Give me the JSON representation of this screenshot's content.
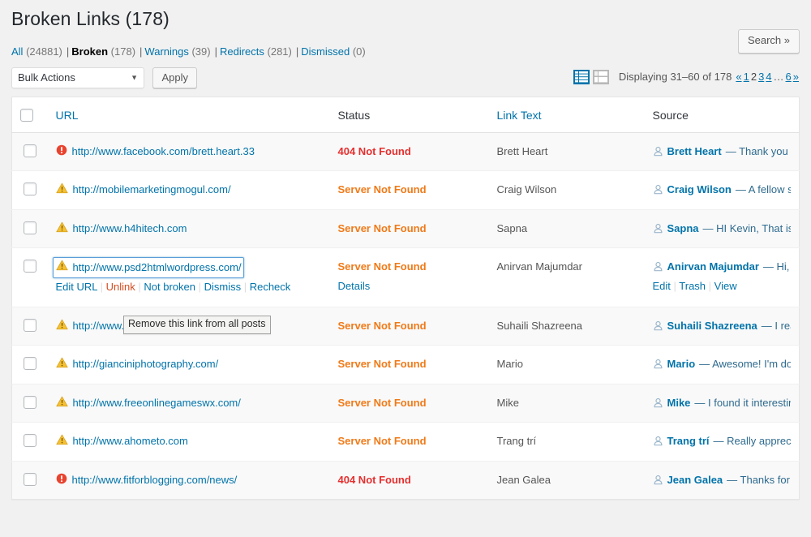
{
  "header": {
    "title": "Broken Links (178)"
  },
  "filters": [
    {
      "label": "All",
      "count": "(24881)",
      "current": false
    },
    {
      "label": "Broken",
      "count": "(178)",
      "current": true
    },
    {
      "label": "Warnings",
      "count": "(39)",
      "current": false
    },
    {
      "label": "Redirects",
      "count": "(281)",
      "current": false
    },
    {
      "label": "Dismissed",
      "count": "(0)",
      "current": false
    }
  ],
  "search": {
    "submit_label": "Search »"
  },
  "toolbar": {
    "bulk_actions_label": "Bulk Actions",
    "apply_label": "Apply",
    "view_list_icon": "list-view-icon",
    "view_detail_icon": "detail-view-icon"
  },
  "pagination": {
    "displaying": "Displaying 31–60 of 178",
    "first": "«",
    "pages": [
      "1",
      "2",
      "3",
      "4"
    ],
    "current_page": "2",
    "dots": "…",
    "last_page": "6",
    "last": "»"
  },
  "table": {
    "columns": [
      {
        "label": "URL",
        "link": true
      },
      {
        "label": "Status",
        "link": false
      },
      {
        "label": "Link Text",
        "link": true
      },
      {
        "label": "Source",
        "link": false
      }
    ],
    "rows": [
      {
        "icon": "error-icon",
        "url": "http://www.facebook.com/brett.heart.33",
        "status": "404 Not Found",
        "status_kind": "404",
        "link_text": "Brett Heart",
        "source_name": "Brett Heart",
        "source_excerpt": "— Thank you for ..."
      },
      {
        "icon": "warning-icon",
        "url": "http://mobilemarketingmogul.com/",
        "status": "Server Not Found",
        "status_kind": "server",
        "link_text": "Craig Wilson",
        "source_name": "Craig Wilson",
        "source_excerpt": "— A fellow scot..."
      },
      {
        "icon": "warning-icon",
        "url": "http://www.h4hitech.com",
        "status": "Server Not Found",
        "status_kind": "server",
        "link_text": "Sapna",
        "source_name": "Sapna",
        "source_excerpt": "— HI Kevin, That is a g..."
      },
      {
        "icon": "warning-icon",
        "url": "http://www.psd2htmlwordpress.com/",
        "status": "Server Not Found",
        "status_kind": "server",
        "link_text": "Anirvan Majumdar",
        "source_name": "Anirvan Majumdar",
        "source_excerpt": "— Hi, Th...",
        "focused": true,
        "url_actions": [
          "Edit URL",
          "Unlink",
          "Not broken",
          "Dismiss",
          "Recheck"
        ],
        "status_actions": [
          "Details"
        ],
        "source_actions": [
          "Edit",
          "Trash",
          "View"
        ]
      },
      {
        "icon": "warning-icon",
        "url": "http://www.fas",
        "status": "Server Not Found",
        "status_kind": "server",
        "link_text": "Suhaili Shazreena",
        "source_name": "Suhaili Shazreena",
        "source_excerpt": "— I really l..."
      },
      {
        "icon": "warning-icon",
        "url": "http://gianciniphotography.com/",
        "status": "Server Not Found",
        "status_kind": "server",
        "link_text": "Mario",
        "source_name": "Mario",
        "source_excerpt": "— Awesome! I'm dow..."
      },
      {
        "icon": "warning-icon",
        "url": "http://www.freeonlinegameswx.com/",
        "status": "Server Not Found",
        "status_kind": "server",
        "link_text": "Mike",
        "source_name": "Mike",
        "source_excerpt": "— I found it interesting ..."
      },
      {
        "icon": "warning-icon",
        "url": "http://www.ahometo.com",
        "status": "Server Not Found",
        "status_kind": "server",
        "link_text": "Trang trí",
        "source_name": "Trang trí",
        "source_excerpt": "— Really appreciate..."
      },
      {
        "icon": "error-icon",
        "url": "http://www.fitforblogging.com/news/",
        "status": "404 Not Found",
        "status_kind": "404",
        "link_text": "Jean Galea",
        "source_name": "Jean Galea",
        "source_excerpt": "— Thanks for sha..."
      }
    ]
  },
  "tooltip": {
    "text": "Remove this link from all posts"
  },
  "colors": {
    "link": "#0073aa",
    "error": "#e62f2f",
    "warning": "#f07a18",
    "delete": "#d54e21"
  }
}
